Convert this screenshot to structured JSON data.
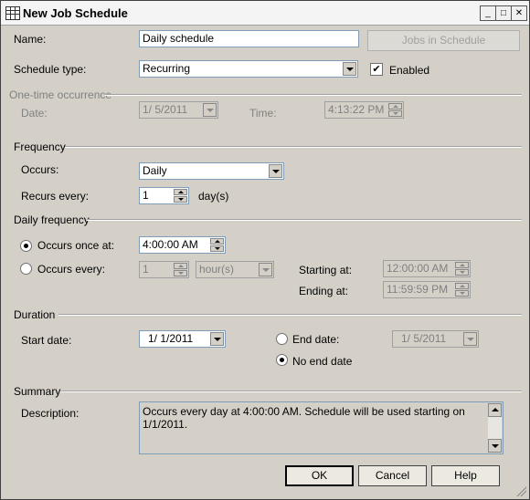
{
  "window": {
    "title": "New Job Schedule",
    "controls": {
      "minimize": "_",
      "maximize": "□",
      "close": "✕"
    }
  },
  "name": {
    "label": "Name:",
    "value": "Daily schedule",
    "jobs_button": "Jobs in Schedule"
  },
  "schedule_type": {
    "label": "Schedule type:",
    "value": "Recurring",
    "enabled_label": "Enabled",
    "enabled_checked": true,
    "check_glyph": "✔"
  },
  "one_time": {
    "section": "One-time occurrence",
    "date_label": "Date:",
    "date_value": "1/  5/2011",
    "time_label": "Time:",
    "time_value": "4:13:22 PM"
  },
  "frequency": {
    "section": "Frequency",
    "occurs_label": "Occurs:",
    "occurs_value": "Daily",
    "recurs_label": "Recurs every:",
    "recurs_value": "1",
    "recurs_unit": "day(s)"
  },
  "daily_frequency": {
    "section": "Daily frequency",
    "once_label": "Occurs once at:",
    "once_value": "4:00:00 AM",
    "once_selected": true,
    "every_label": "Occurs every:",
    "every_value": "1",
    "every_unit": "hour(s)",
    "starting_label": "Starting at:",
    "starting_value": "12:00:00 AM",
    "ending_label": "Ending at:",
    "ending_value": "11:59:59 PM"
  },
  "duration": {
    "section": "Duration",
    "start_label": "Start date:",
    "start_value": "1/  1/2011",
    "end_label": "End date:",
    "end_value": "1/  5/2011",
    "no_end_label": "No end date",
    "no_end_selected": true
  },
  "summary": {
    "section": "Summary",
    "desc_label": "Description:",
    "desc_text": "Occurs every day at 4:00:00 AM. Schedule will be used starting on 1/1/2011."
  },
  "buttons": {
    "ok": "OK",
    "cancel": "Cancel",
    "help": "Help"
  }
}
